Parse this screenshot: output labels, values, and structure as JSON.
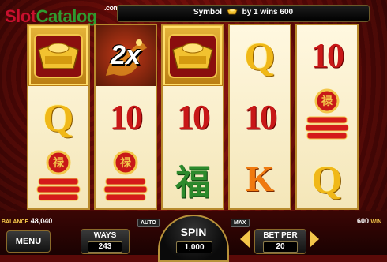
{
  "logo": {
    "slot": "Slot",
    "catalog": "Catalog",
    "com": ".com"
  },
  "win_line": {
    "prefix": "Symbol",
    "suffix": "by 1 wins 600"
  },
  "reels": [
    [
      "gold-ingot",
      "Q",
      "firecracker-seal"
    ],
    [
      "2x",
      "10",
      "firecracker-seal"
    ],
    [
      "gold-ingot",
      "10",
      "fu"
    ],
    [
      "Q",
      "10",
      "K"
    ],
    [
      "10",
      "firecracker-seal",
      "Q"
    ]
  ],
  "symbols": {
    "ten": "10",
    "q": "Q",
    "k": "K",
    "multiplier": "2x",
    "fu": "福",
    "seal": "禄"
  },
  "balance": {
    "label": "BALANCE",
    "value": "48,040"
  },
  "win": {
    "value": "600",
    "label": "WIN"
  },
  "buttons": {
    "menu": "MENU",
    "auto": "AUTO",
    "max": "MAX",
    "spin": "SPIN"
  },
  "ways": {
    "label": "WAYS",
    "value": "243"
  },
  "spin_value": "1,000",
  "bet_per": {
    "label": "BET PER",
    "value": "20"
  },
  "colors": {
    "reel_frame": "#b88a2c",
    "ten_red": "#c81818",
    "q_gold": "#f0b818",
    "k_orange": "#f07a10"
  }
}
